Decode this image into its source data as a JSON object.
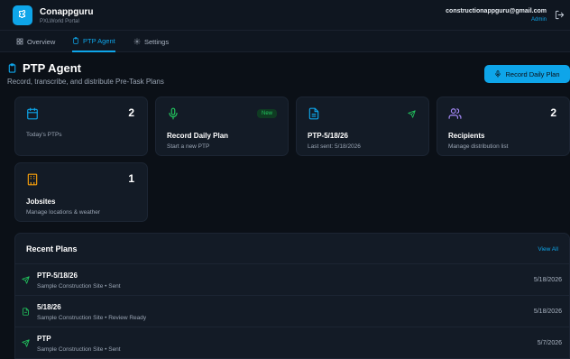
{
  "header": {
    "brand_title": "Conappguru",
    "brand_subtitle": "PXLWorld Portal",
    "user_email": "constructionappguru@gmail.com",
    "user_role": "Admin"
  },
  "tabs": [
    {
      "label": "Overview",
      "icon": "grid-icon",
      "active": false
    },
    {
      "label": "PTP Agent",
      "icon": "clipboard-icon",
      "active": true
    },
    {
      "label": "Settings",
      "icon": "gear-icon",
      "active": false
    }
  ],
  "page": {
    "title": "PTP Agent",
    "subtitle": "Record, transcribe, and distribute Pre-Task Plans",
    "record_button": "Record Daily Plan"
  },
  "cards": {
    "todays_ptps": {
      "count": "2",
      "label": "Today's PTPs",
      "icon": "calendar-icon"
    },
    "record": {
      "title": "Record Daily Plan",
      "subtitle": "Start a new PTP",
      "badge": "New",
      "icon": "mic-icon"
    },
    "last_ptp": {
      "title": "PTP-5/18/26",
      "subtitle": "Last sent: 5/18/2026",
      "icon": "document-icon"
    },
    "recipients": {
      "count": "2",
      "title": "Recipients",
      "subtitle": "Manage distribution list",
      "icon": "users-icon"
    },
    "jobsites": {
      "count": "1",
      "title": "Jobsites",
      "subtitle": "Manage locations & weather",
      "icon": "building-icon"
    }
  },
  "recent": {
    "title": "Recent Plans",
    "view_all": "View All",
    "rows": [
      {
        "title": "PTP-5/18/26",
        "subtitle": "Sample Construction Site • Sent",
        "date": "5/18/2026",
        "icon": "send-icon"
      },
      {
        "title": "5/18/26",
        "subtitle": "Sample Construction Site • Review Ready",
        "date": "5/18/2026",
        "icon": "document-icon"
      },
      {
        "title": "PTP",
        "subtitle": "Sample Construction Site • Sent",
        "date": "5/7/2026",
        "icon": "send-icon"
      }
    ]
  },
  "colors": {
    "accent": "#0ea5e9",
    "success": "#22c55e",
    "warning": "#f59e0b",
    "purple": "#a78bfa",
    "background": "#0b1017",
    "card": "#131b26"
  }
}
